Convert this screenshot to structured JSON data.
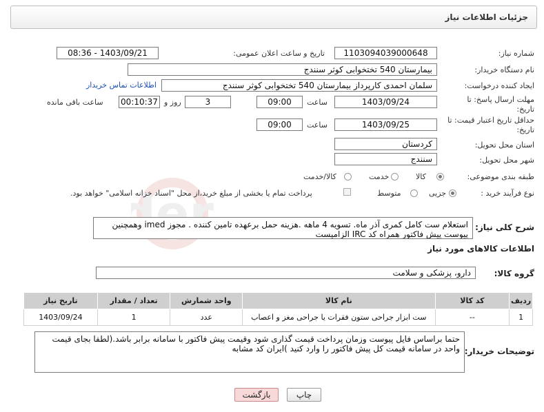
{
  "panel": {
    "title": "جزئیات اطلاعات نیاز"
  },
  "fields": {
    "need_number_label": "شماره نیاز:",
    "need_number": "1103094039000648",
    "announce_label": "تاریخ و ساعت اعلان عمومی:",
    "announce_value": "1403/09/21 - 08:36",
    "buyer_org_label": "نام دستگاه خریدار:",
    "buyer_org": "بیمارستان 540 تختخوابی کوثر سنندج",
    "creator_label": "ایجاد کننده درخواست:",
    "creator": "سلمان احمدی کارپرداز بیمارستان 540 تختخوابی کوثر سنندج",
    "contact_link": "اطلاعات تماس خریدار",
    "reply_deadline_label": "مهلت ارسال پاسخ: تا تاریخ:",
    "reply_date": "1403/09/24",
    "time_label": "ساعت",
    "reply_time": "09:00",
    "days_value": "3",
    "days_label": "روز و",
    "remaining_time": "00:10:37",
    "remaining_label": "ساعت باقی مانده",
    "price_valid_label": "حداقل تاریخ اعتبار قیمت: تا تاریخ:",
    "price_valid_date": "1403/09/25",
    "price_valid_time": "09:00",
    "province_label": "استان محل تحویل:",
    "province": "کردستان",
    "city_label": "شهر محل تحویل:",
    "city": "سنندج",
    "category_label": "طبقه بندی موضوعی:",
    "category_options": [
      "کالا",
      "خدمت",
      "کالا/خدمت"
    ],
    "process_label": "نوع فرآیند خرید :",
    "process_options": [
      "جزیی",
      "متوسط"
    ],
    "payment_note": "پرداخت تمام یا بخشی از مبلغ خرید،از محل \"اسناد خزانه اسلامی\" خواهد بود."
  },
  "description": {
    "label": "شرح کلی نیاز:",
    "text": "استعلام ست کامل کمری آذر ماه. تسویه 4 ماهه .هزینه حمل برعهده تامین کننده . مجوز imed وهمچنین پیوست پیش فاکتور همراه کد IRC الزامیست"
  },
  "goods_section": {
    "title": "اطلاعات کالاهای مورد نیاز"
  },
  "goods_group": {
    "label": "گروه کالا:",
    "value": "دارو، پزشکی و سلامت"
  },
  "table": {
    "headers": [
      "ردیف",
      "کد کالا",
      "نام کالا",
      "واحد شمارش",
      "تعداد / مقدار",
      "تاریخ نیاز"
    ],
    "rows": [
      [
        "1",
        "--",
        "ست ابزار جراحی ستون فقرات یا جراحی مغز و اعصاب",
        "عدد",
        "1",
        "1403/09/24"
      ]
    ]
  },
  "buyer_notes": {
    "label": "توضیحات خریدار:",
    "text": "حتما براساس فایل پیوست  وزمان پرداخت قیمت گذاری شود وقیمت پیش فاکتور با سامانه برابر باشد.(لطفا بجای قیمت واحد در سامانه قیمت کل پیش فاکتور را وارد کنید )ایران کد مشابه"
  },
  "buttons": {
    "print": "چاپ",
    "back": "بازگشت"
  },
  "colors": {
    "back_button": "#f7d9d9",
    "link": "#1a4fb3",
    "table_header": "#cfcfcf"
  }
}
